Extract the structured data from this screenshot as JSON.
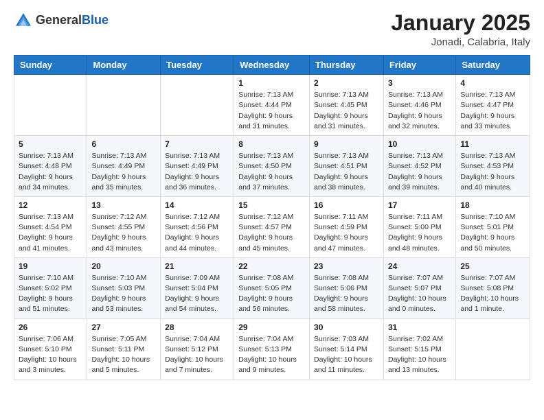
{
  "logo": {
    "general": "General",
    "blue": "Blue"
  },
  "header": {
    "month": "January 2025",
    "location": "Jonadi, Calabria, Italy"
  },
  "weekdays": [
    "Sunday",
    "Monday",
    "Tuesday",
    "Wednesday",
    "Thursday",
    "Friday",
    "Saturday"
  ],
  "weeks": [
    [
      {
        "day": "",
        "info": ""
      },
      {
        "day": "",
        "info": ""
      },
      {
        "day": "",
        "info": ""
      },
      {
        "day": "1",
        "info": "Sunrise: 7:13 AM\nSunset: 4:44 PM\nDaylight: 9 hours and 31 minutes."
      },
      {
        "day": "2",
        "info": "Sunrise: 7:13 AM\nSunset: 4:45 PM\nDaylight: 9 hours and 31 minutes."
      },
      {
        "day": "3",
        "info": "Sunrise: 7:13 AM\nSunset: 4:46 PM\nDaylight: 9 hours and 32 minutes."
      },
      {
        "day": "4",
        "info": "Sunrise: 7:13 AM\nSunset: 4:47 PM\nDaylight: 9 hours and 33 minutes."
      }
    ],
    [
      {
        "day": "5",
        "info": "Sunrise: 7:13 AM\nSunset: 4:48 PM\nDaylight: 9 hours and 34 minutes."
      },
      {
        "day": "6",
        "info": "Sunrise: 7:13 AM\nSunset: 4:49 PM\nDaylight: 9 hours and 35 minutes."
      },
      {
        "day": "7",
        "info": "Sunrise: 7:13 AM\nSunset: 4:49 PM\nDaylight: 9 hours and 36 minutes."
      },
      {
        "day": "8",
        "info": "Sunrise: 7:13 AM\nSunset: 4:50 PM\nDaylight: 9 hours and 37 minutes."
      },
      {
        "day": "9",
        "info": "Sunrise: 7:13 AM\nSunset: 4:51 PM\nDaylight: 9 hours and 38 minutes."
      },
      {
        "day": "10",
        "info": "Sunrise: 7:13 AM\nSunset: 4:52 PM\nDaylight: 9 hours and 39 minutes."
      },
      {
        "day": "11",
        "info": "Sunrise: 7:13 AM\nSunset: 4:53 PM\nDaylight: 9 hours and 40 minutes."
      }
    ],
    [
      {
        "day": "12",
        "info": "Sunrise: 7:13 AM\nSunset: 4:54 PM\nDaylight: 9 hours and 41 minutes."
      },
      {
        "day": "13",
        "info": "Sunrise: 7:12 AM\nSunset: 4:55 PM\nDaylight: 9 hours and 43 minutes."
      },
      {
        "day": "14",
        "info": "Sunrise: 7:12 AM\nSunset: 4:56 PM\nDaylight: 9 hours and 44 minutes."
      },
      {
        "day": "15",
        "info": "Sunrise: 7:12 AM\nSunset: 4:57 PM\nDaylight: 9 hours and 45 minutes."
      },
      {
        "day": "16",
        "info": "Sunrise: 7:11 AM\nSunset: 4:59 PM\nDaylight: 9 hours and 47 minutes."
      },
      {
        "day": "17",
        "info": "Sunrise: 7:11 AM\nSunset: 5:00 PM\nDaylight: 9 hours and 48 minutes."
      },
      {
        "day": "18",
        "info": "Sunrise: 7:10 AM\nSunset: 5:01 PM\nDaylight: 9 hours and 50 minutes."
      }
    ],
    [
      {
        "day": "19",
        "info": "Sunrise: 7:10 AM\nSunset: 5:02 PM\nDaylight: 9 hours and 51 minutes."
      },
      {
        "day": "20",
        "info": "Sunrise: 7:10 AM\nSunset: 5:03 PM\nDaylight: 9 hours and 53 minutes."
      },
      {
        "day": "21",
        "info": "Sunrise: 7:09 AM\nSunset: 5:04 PM\nDaylight: 9 hours and 54 minutes."
      },
      {
        "day": "22",
        "info": "Sunrise: 7:08 AM\nSunset: 5:05 PM\nDaylight: 9 hours and 56 minutes."
      },
      {
        "day": "23",
        "info": "Sunrise: 7:08 AM\nSunset: 5:06 PM\nDaylight: 9 hours and 58 minutes."
      },
      {
        "day": "24",
        "info": "Sunrise: 7:07 AM\nSunset: 5:07 PM\nDaylight: 10 hours and 0 minutes."
      },
      {
        "day": "25",
        "info": "Sunrise: 7:07 AM\nSunset: 5:08 PM\nDaylight: 10 hours and 1 minute."
      }
    ],
    [
      {
        "day": "26",
        "info": "Sunrise: 7:06 AM\nSunset: 5:10 PM\nDaylight: 10 hours and 3 minutes."
      },
      {
        "day": "27",
        "info": "Sunrise: 7:05 AM\nSunset: 5:11 PM\nDaylight: 10 hours and 5 minutes."
      },
      {
        "day": "28",
        "info": "Sunrise: 7:04 AM\nSunset: 5:12 PM\nDaylight: 10 hours and 7 minutes."
      },
      {
        "day": "29",
        "info": "Sunrise: 7:04 AM\nSunset: 5:13 PM\nDaylight: 10 hours and 9 minutes."
      },
      {
        "day": "30",
        "info": "Sunrise: 7:03 AM\nSunset: 5:14 PM\nDaylight: 10 hours and 11 minutes."
      },
      {
        "day": "31",
        "info": "Sunrise: 7:02 AM\nSunset: 5:15 PM\nDaylight: 10 hours and 13 minutes."
      },
      {
        "day": "",
        "info": ""
      }
    ]
  ]
}
